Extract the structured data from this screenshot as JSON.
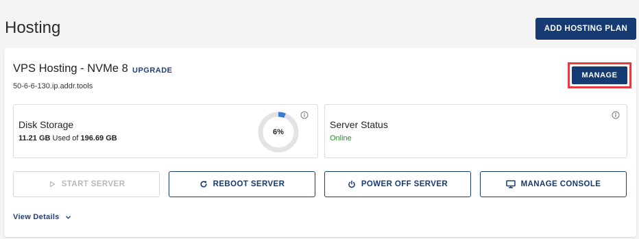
{
  "page": {
    "title": "Hosting"
  },
  "header": {
    "add_plan_label": "ADD HOSTING PLAN"
  },
  "plan": {
    "name": "VPS Hosting - NVMe 8",
    "upgrade_label": "UPGRADE",
    "hostname": "50-6-6-130.ip.addr.tools",
    "manage_label": "MANAGE"
  },
  "disk": {
    "title": "Disk Storage",
    "used": "11.21 GB",
    "used_of": "Used of",
    "total": "196.69 GB",
    "percent_label": "6%",
    "percent_value": 0.06
  },
  "server_status": {
    "title": "Server Status",
    "value": "Online"
  },
  "actions": {
    "start": "START SERVER",
    "reboot": "REBOOT SERVER",
    "power_off": "POWER OFF SERVER",
    "console": "MANAGE CONSOLE"
  },
  "view_details_label": "View Details",
  "colors": {
    "primary": "#163a72",
    "highlight_border": "#e53a3f",
    "gauge_fill": "#3a7bd5",
    "gauge_track": "#e3e3e3",
    "status_online": "#2e8b2e"
  }
}
